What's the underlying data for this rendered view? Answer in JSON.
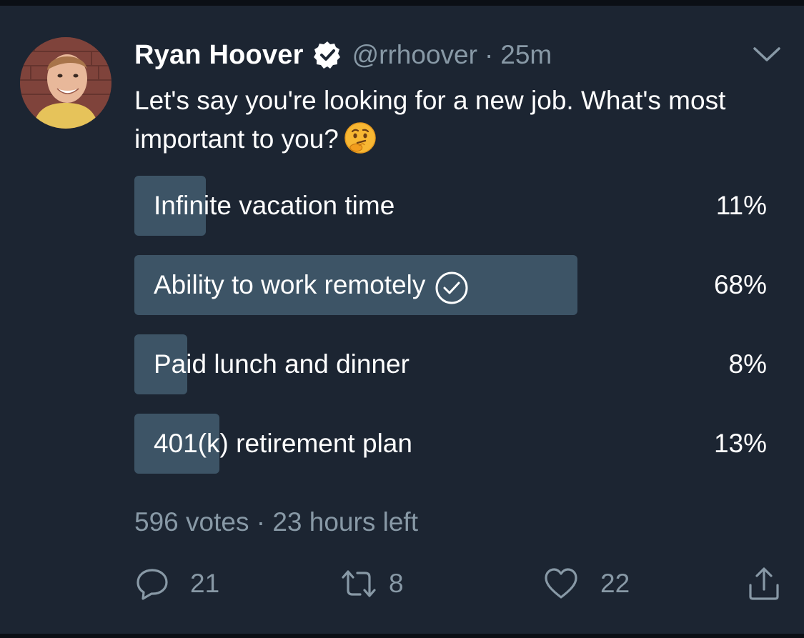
{
  "tweet": {
    "display_name": "Ryan Hoover",
    "handle": "@rrhoover",
    "separator": "·",
    "time": "25m",
    "text": "Let's say you're looking for a new job. What's most important to you?",
    "emoji": "thinking-face"
  },
  "poll": {
    "options": [
      {
        "label": "Infinite vacation time",
        "percent_text": "11%",
        "percent": 11,
        "selected": false
      },
      {
        "label": "Ability to work remotely",
        "percent_text": "68%",
        "percent": 68,
        "selected": true
      },
      {
        "label": "Paid lunch and dinner",
        "percent_text": "8%",
        "percent": 8,
        "selected": false
      },
      {
        "label": "401(k) retirement plan",
        "percent_text": "13%",
        "percent": 13,
        "selected": false
      }
    ],
    "votes": "596 votes",
    "separator": "·",
    "time_left": "23 hours left"
  },
  "actions": {
    "replies": "21",
    "retweets": "8",
    "likes": "22"
  },
  "icons": {
    "verified": "verified-badge-icon",
    "menu": "chevron-down-icon",
    "selected": "check-circle-icon",
    "reply": "reply-icon",
    "retweet": "retweet-icon",
    "like": "heart-icon",
    "share": "share-icon"
  },
  "colors": {
    "background": "#1c2532",
    "bar": "#3d5466",
    "muted_text": "#8899a6",
    "text": "#ffffff"
  }
}
